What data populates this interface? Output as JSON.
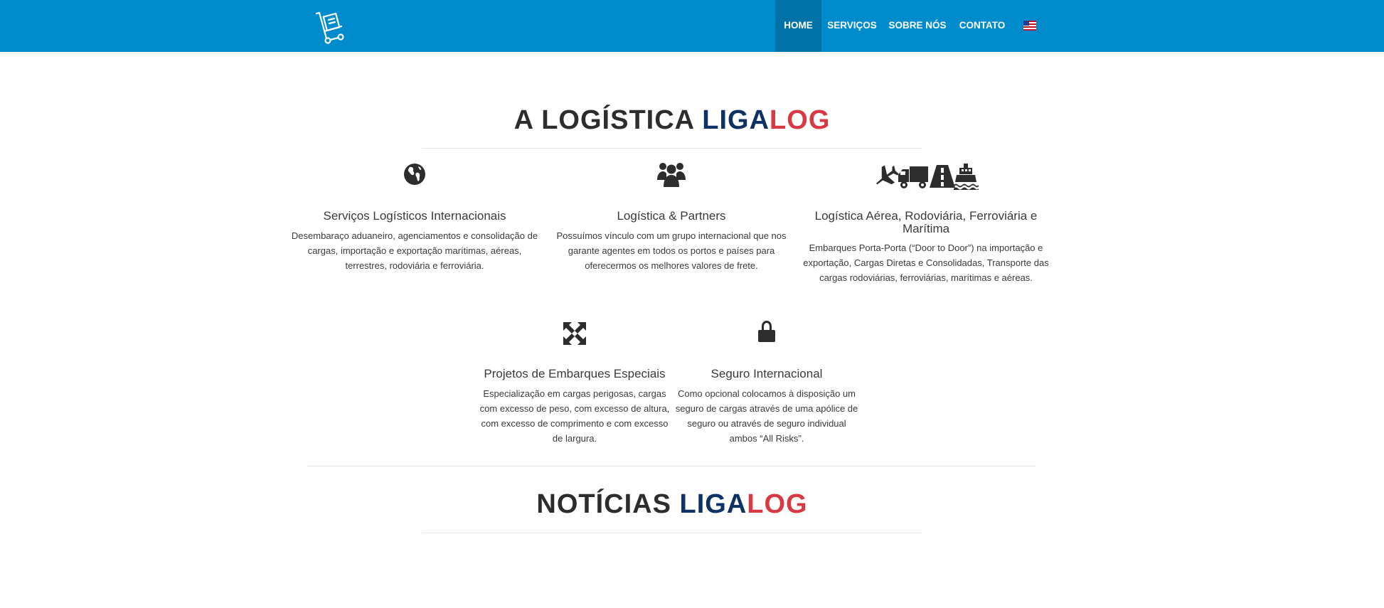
{
  "header": {
    "logo_icon": "hand-truck-icon",
    "nav": [
      {
        "label": "HOME",
        "active": true
      },
      {
        "label": "SERVIÇOS",
        "active": false
      },
      {
        "label": "SOBRE NÓS",
        "active": false
      },
      {
        "label": "CONTATO",
        "active": false
      }
    ],
    "language_icon": "us-flag-icon"
  },
  "about": {
    "title_prefix": "A LOGÍSTICA",
    "brand_liga": "LIGA",
    "brand_log": "LOG",
    "features": [
      {
        "icon": "globe-icon",
        "title": "Serviços Logísticos Internacionais",
        "text": "Desembaraço aduaneiro, agenciamentos e consolidação de cargas, importação e exportação marítimas, aéreas, terrestres, rodoviária e ferroviária."
      },
      {
        "icon": "users-icon",
        "title": "Logística & Partners",
        "text": "Possuímos vínculo com um grupo internacional que nos garante agentes em todos os portos e países para oferecermos os melhores valores de frete."
      },
      {
        "icon": "transport-icons",
        "title": "Logística Aérea, Rodoviária, Ferroviária e Marítima",
        "text": "Embarques Porta-Porta (“Door to Door”) na importação e exportação, Cargas Diretas e Consolidadas, Transporte das cargas rodoviárias, ferroviárias, marítimas e aéreas."
      },
      {
        "icon": "expand-arrows-icon",
        "title": "Projetos de Embarques Especiais",
        "text": "Especialização em cargas perigosas, cargas com excesso de peso, com excesso de altura, com excesso de comprimento e com excesso de largura."
      },
      {
        "icon": "lock-icon",
        "title": "Seguro Internacional",
        "text": "Como opcional colocamos à disposição um seguro de cargas através de uma apólice de seguro ou através de seguro individual ambos “All Risks”."
      }
    ]
  },
  "news": {
    "title_prefix": "NOTÍCIAS",
    "brand_liga": "LIGA",
    "brand_log": "LOG"
  },
  "colors": {
    "header_bg": "#008ccc",
    "nav_active_bg": "#0072a8",
    "brand_blue": "#0f3266",
    "brand_red": "#d83a45",
    "text_dark": "#2d2d2d"
  }
}
